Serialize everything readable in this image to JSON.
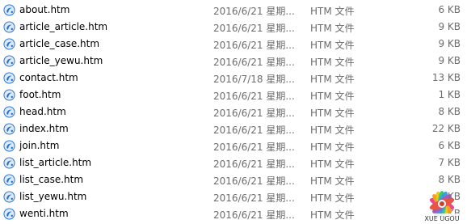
{
  "files": [
    {
      "name": "about.htm",
      "date": "2016/6/21 星期...",
      "type": "HTM 文件",
      "size": "6 KB"
    },
    {
      "name": "article_article.htm",
      "date": "2016/6/21 星期...",
      "type": "HTM 文件",
      "size": "9 KB"
    },
    {
      "name": "article_case.htm",
      "date": "2016/6/21 星期...",
      "type": "HTM 文件",
      "size": "9 KB"
    },
    {
      "name": "article_yewu.htm",
      "date": "2016/6/21 星期...",
      "type": "HTM 文件",
      "size": "9 KB"
    },
    {
      "name": "contact.htm",
      "date": "2016/7/18 星期...",
      "type": "HTM 文件",
      "size": "13 KB"
    },
    {
      "name": "foot.htm",
      "date": "2016/6/21 星期...",
      "type": "HTM 文件",
      "size": "1 KB"
    },
    {
      "name": "head.htm",
      "date": "2016/6/21 星期...",
      "type": "HTM 文件",
      "size": "8 KB"
    },
    {
      "name": "index.htm",
      "date": "2016/6/21 星期...",
      "type": "HTM 文件",
      "size": "22 KB"
    },
    {
      "name": "join.htm",
      "date": "2016/6/21 星期...",
      "type": "HTM 文件",
      "size": "6 KB"
    },
    {
      "name": "list_article.htm",
      "date": "2016/6/21 星期...",
      "type": "HTM 文件",
      "size": "7 KB"
    },
    {
      "name": "list_case.htm",
      "date": "2016/6/21 星期...",
      "type": "HTM 文件",
      "size": "8 KB"
    },
    {
      "name": "list_yewu.htm",
      "date": "2016/6/21 星期...",
      "type": "HTM 文件",
      "size": "8 KB"
    },
    {
      "name": "wenti.htm",
      "date": "2016/6/21 星期...",
      "type": "HTM 文件",
      "size": "11 KB"
    }
  ],
  "icons": {
    "file_icon": "html-file-icon",
    "watermark": "peacock-logo-watermark"
  },
  "watermark": {
    "text": "XUE UGOU"
  },
  "colors": {
    "name_text": "#000000",
    "meta_text": "#6d6d6d",
    "icon_blue": "#1f6fd1",
    "background": "#ffffff"
  }
}
